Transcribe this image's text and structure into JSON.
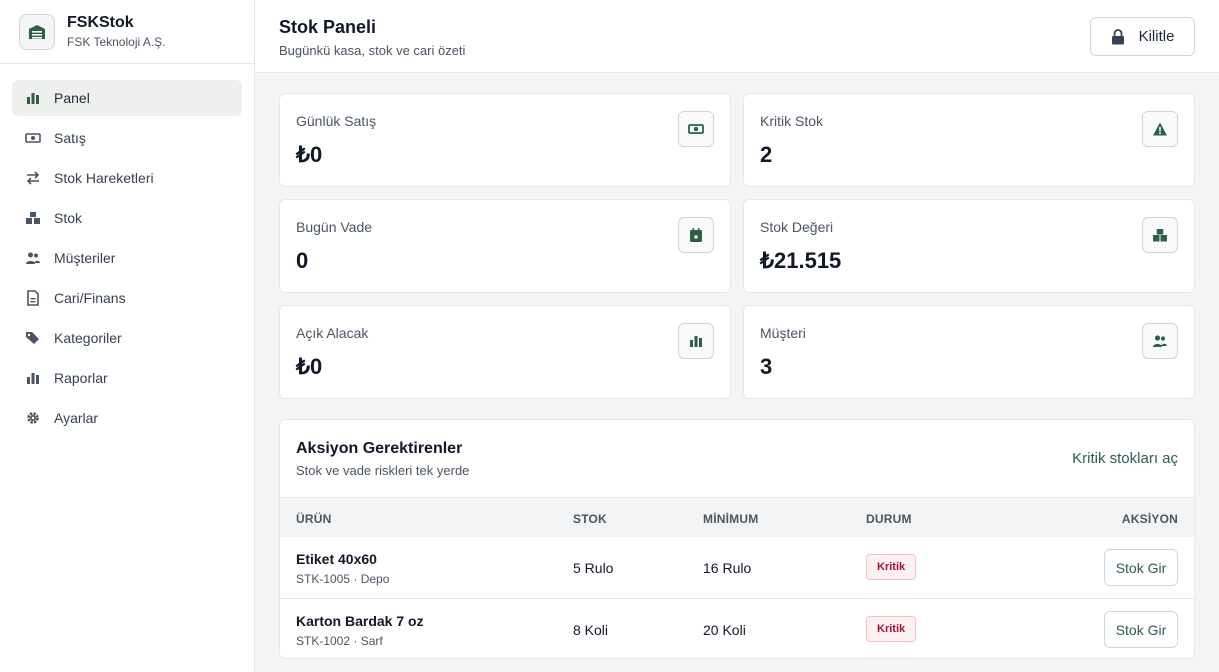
{
  "brand": {
    "name": "FSKStok",
    "company": "FSK Teknoloji A.Ş."
  },
  "sidebar": {
    "items": [
      {
        "label": "Panel",
        "icon": "chart-bar-icon",
        "active": true
      },
      {
        "label": "Satış",
        "icon": "cash-icon"
      },
      {
        "label": "Stok Hareketleri",
        "icon": "swap-arrows-icon"
      },
      {
        "label": "Stok",
        "icon": "boxes-icon"
      },
      {
        "label": "Müşteriler",
        "icon": "users-icon"
      },
      {
        "label": "Cari/Finans",
        "icon": "document-icon"
      },
      {
        "label": "Kategoriler",
        "icon": "tags-icon"
      },
      {
        "label": "Raporlar",
        "icon": "chart-bar-icon"
      },
      {
        "label": "Ayarlar",
        "icon": "gear-icon"
      }
    ]
  },
  "header": {
    "title": "Stok Paneli",
    "subtitle": "Bugünkü kasa, stok ve cari özeti",
    "lock_label": "Kilitle"
  },
  "cards": [
    {
      "label": "Günlük Satış",
      "value": "₺0",
      "icon": "cash-icon"
    },
    {
      "label": "Kritik Stok",
      "value": "2",
      "icon": "warning-icon"
    },
    {
      "label": "Bugün Vade",
      "value": "0",
      "icon": "calendar-icon"
    },
    {
      "label": "Stok Değeri",
      "value": "₺21.515",
      "icon": "boxes-icon"
    },
    {
      "label": "Açık Alacak",
      "value": "₺0",
      "icon": "chart-bar-icon"
    },
    {
      "label": "Müşteri",
      "value": "3",
      "icon": "users-icon"
    }
  ],
  "actions": {
    "title": "Aksiyon Gerektirenler",
    "subtitle": "Stok ve vade riskleri tek yerde",
    "link": "Kritik stokları aç",
    "columns": [
      "ÜRÜN",
      "STOK",
      "MİNİMUM",
      "DURUM",
      "AKSİYON"
    ],
    "rows": [
      {
        "name": "Etiket 40x60",
        "code": "STK-1005 · Depo",
        "stock": "5 Rulo",
        "minimum": "16 Rulo",
        "status": "Kritik",
        "action": "Stok Gir"
      },
      {
        "name": "Karton Bardak 7 oz",
        "code": "STK-1002 · Sarf",
        "stock": "8 Koli",
        "minimum": "20 Koli",
        "status": "Kritik",
        "action": "Stok Gir"
      }
    ]
  },
  "colors": {
    "accent": "#2f5f46",
    "danger": "#9f1239"
  }
}
